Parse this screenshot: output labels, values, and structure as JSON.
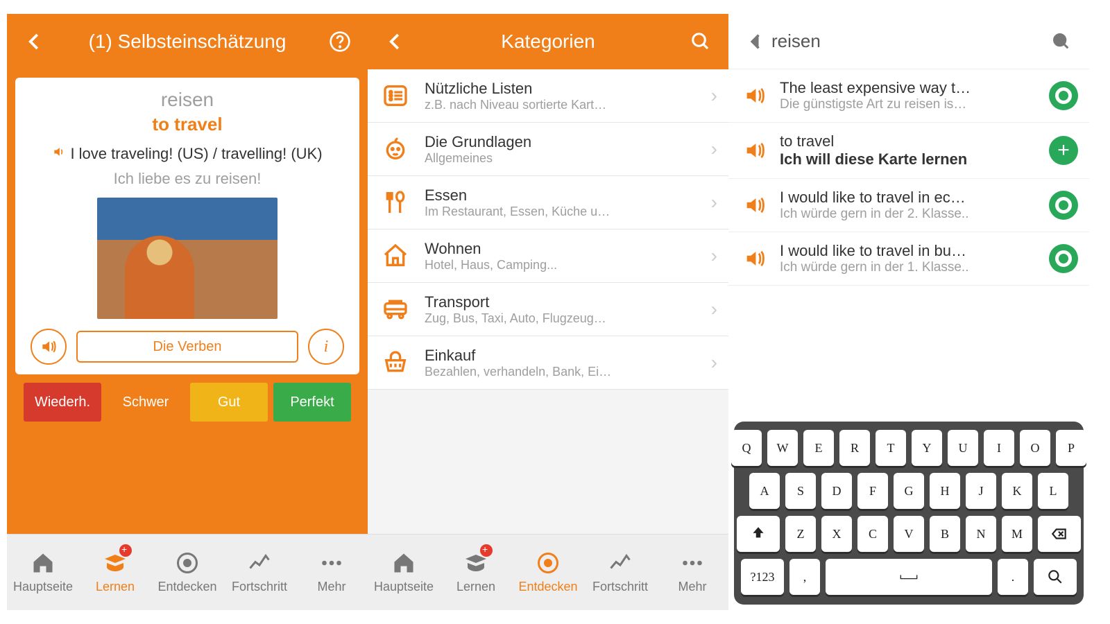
{
  "screen1": {
    "header": {
      "title": "(1) Selbsteinschätzung"
    },
    "card": {
      "word": "reisen",
      "translation": "to travel",
      "sentence_en": "I love traveling! (US) / travelling! (UK)",
      "sentence_de": "Ich liebe es zu reisen!",
      "chip_label": "Die Verben"
    },
    "rating": {
      "again": "Wiederh.",
      "hard": "Schwer",
      "good": "Gut",
      "perfect": "Perfekt"
    }
  },
  "screen2": {
    "header": {
      "title": "Kategorien"
    },
    "categories": [
      {
        "title": "Nützliche Listen",
        "subtitle": "z.B. nach Niveau sortierte Kart…",
        "icon": "list"
      },
      {
        "title": "Die Grundlagen",
        "subtitle": "Allgemeines",
        "icon": "baby"
      },
      {
        "title": "Essen",
        "subtitle": "Im Restaurant, Essen, Küche u…",
        "icon": "food"
      },
      {
        "title": "Wohnen",
        "subtitle": "Hotel, Haus, Camping...",
        "icon": "home"
      },
      {
        "title": "Transport",
        "subtitle": "Zug, Bus, Taxi, Auto, Flugzeug…",
        "icon": "bus"
      },
      {
        "title": "Einkauf",
        "subtitle": "Bezahlen, verhandeln, Bank, Ei…",
        "icon": "basket"
      }
    ]
  },
  "screen3": {
    "search_query": "reisen",
    "results": [
      {
        "title": "The least expensive way t…",
        "subtitle": "Die günstigste Art zu reisen is…",
        "action": "target",
        "bold": false
      },
      {
        "title": "to travel",
        "subtitle": "Ich will diese Karte lernen",
        "action": "plus",
        "bold": true
      },
      {
        "title": "I would like to travel in ec…",
        "subtitle": "Ich würde gern in der 2. Klasse..",
        "action": "target",
        "bold": false
      },
      {
        "title": "I would like to travel in bu…",
        "subtitle": "Ich würde gern in der 1. Klasse..",
        "action": "target",
        "bold": false
      }
    ],
    "keyboard": {
      "row1": [
        "Q",
        "W",
        "E",
        "R",
        "T",
        "Y",
        "U",
        "I",
        "O",
        "P"
      ],
      "row2": [
        "A",
        "S",
        "D",
        "F",
        "G",
        "H",
        "J",
        "K",
        "L"
      ],
      "row3_letters": [
        "Z",
        "X",
        "C",
        "V",
        "B",
        "N",
        "M"
      ],
      "sym_key": "?123",
      "period": "."
    }
  },
  "tabs": {
    "home": "Hauptseite",
    "learn": "Lernen",
    "discover": "Entdecken",
    "progress": "Fortschritt",
    "more": "Mehr"
  }
}
